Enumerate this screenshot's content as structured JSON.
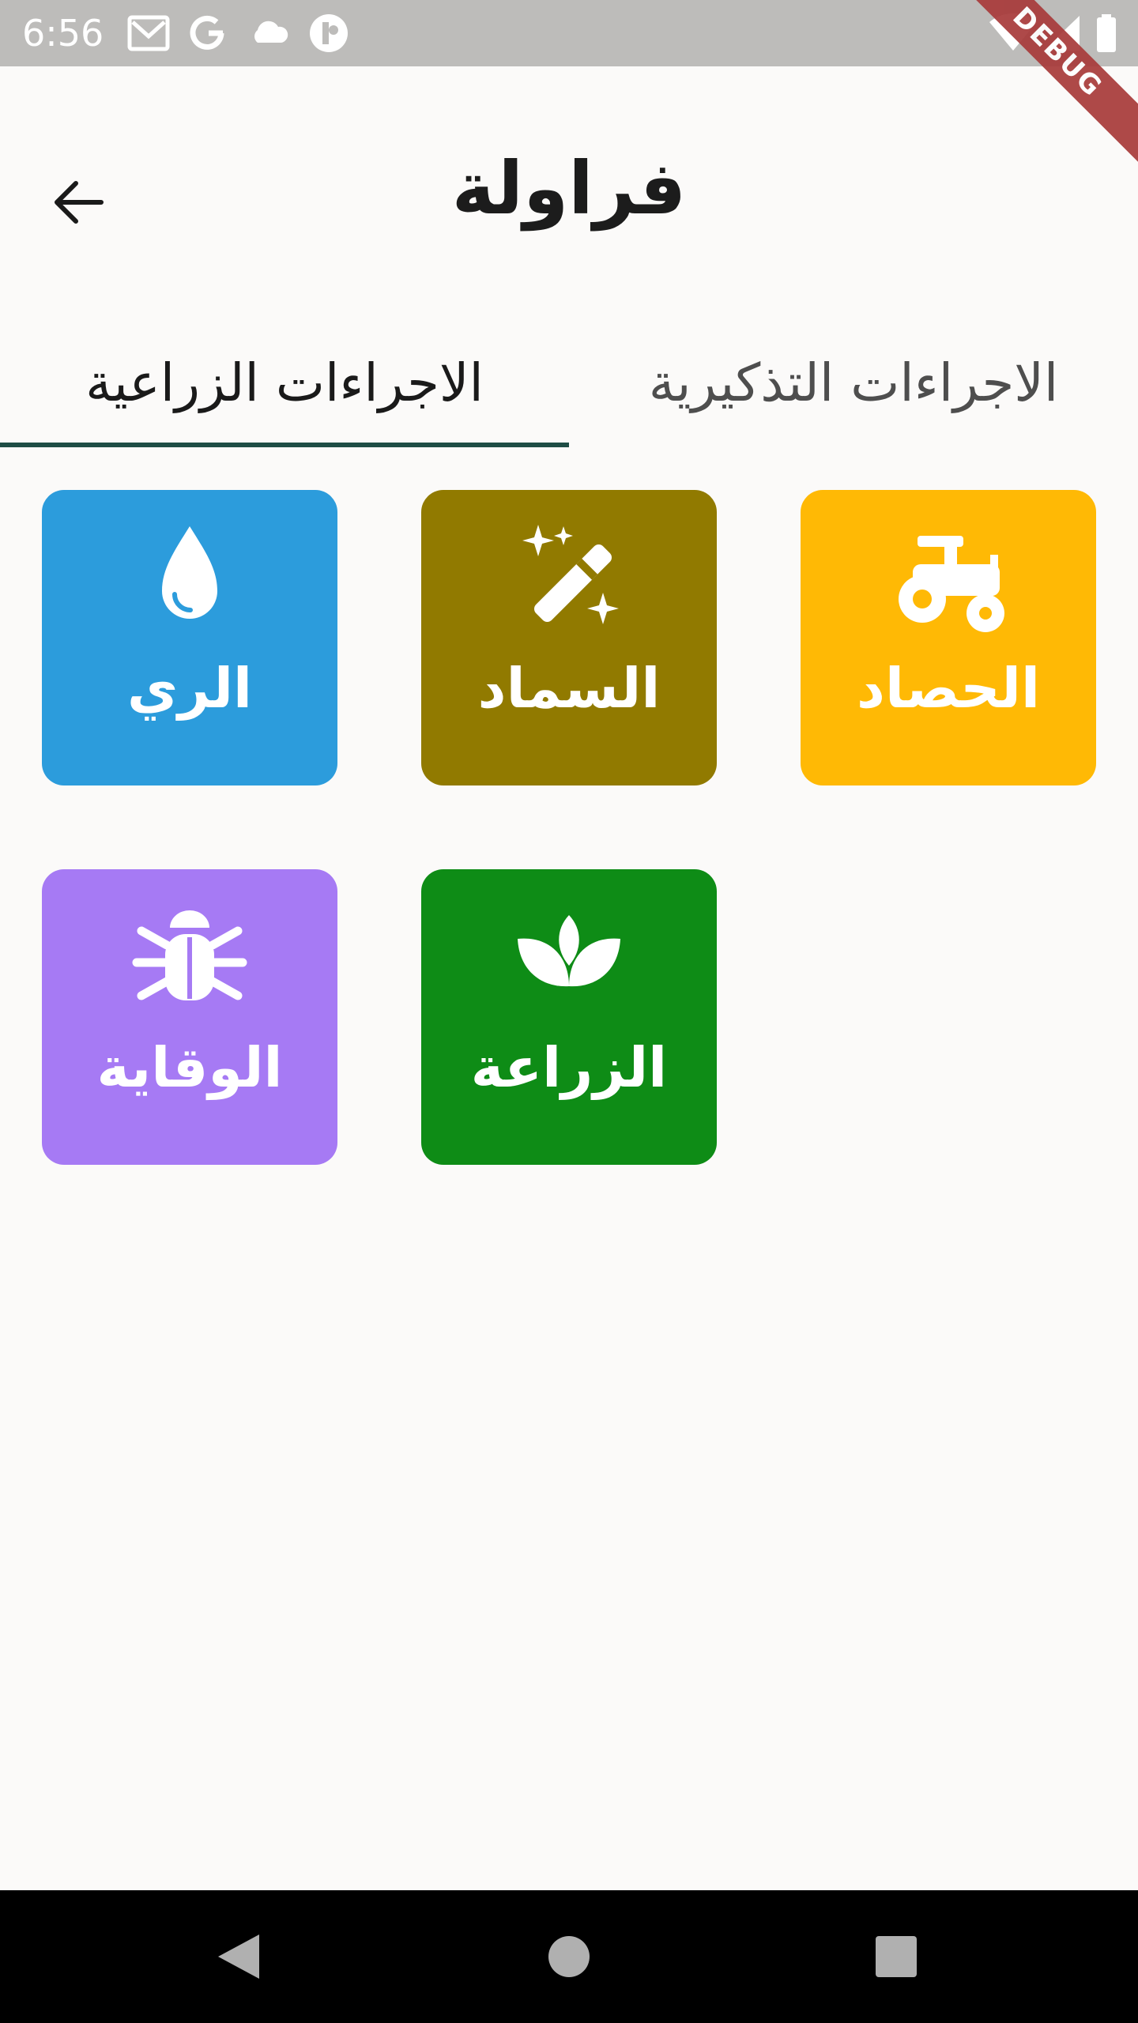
{
  "status_bar": {
    "time": "6:56",
    "icons": [
      "gmail-icon",
      "google-icon",
      "cloud-icon",
      "app-icon",
      "wifi-icon",
      "signal-icon",
      "battery-icon"
    ],
    "debug_label": "DEBUG"
  },
  "app_bar": {
    "title": "فراولة",
    "back_icon": "arrow-back-icon"
  },
  "tabs": [
    {
      "label": "الاجراءات الزراعية",
      "active": true
    },
    {
      "label": "الاجراءات التذكيرية",
      "active": false
    }
  ],
  "tiles": [
    {
      "label": "الحصاد",
      "icon": "tractor-icon",
      "color": "#ffb905"
    },
    {
      "label": "السماد",
      "icon": "magic-wand-icon",
      "color": "#917a00"
    },
    {
      "label": "الري",
      "icon": "water-drop-icon",
      "color": "#2c9cdc"
    },
    {
      "label": "الزراعة",
      "icon": "plant-icon",
      "color": "#0e8c16"
    },
    {
      "label": "الوقاية",
      "icon": "bug-icon",
      "color": "#a67af4"
    }
  ],
  "colors": {
    "background": "#fbfaf9",
    "tab_indicator": "#1e4d45",
    "status_bar": "#bdbcba"
  },
  "nav_bar": {
    "buttons": [
      "back-triangle-icon",
      "home-circle-icon",
      "recents-square-icon"
    ]
  }
}
